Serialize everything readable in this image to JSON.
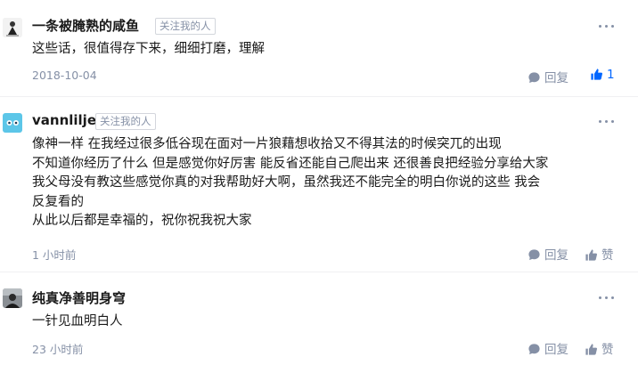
{
  "comments": [
    {
      "author": "一条被腌熟的咸鱼",
      "follow_tag": "关注我的人",
      "lines": [
        "这些话，很值得存下来，细细打磨，理解"
      ],
      "time": "2018-10-04",
      "reply_label": "回复",
      "like_label": "1",
      "liked": true
    },
    {
      "author": "vannlilje",
      "follow_tag": "关注我的人",
      "lines": [
        "像神一样 在我经过很多低谷现在面对一片狼藉想收拾又不得其法的时候突兀的出现",
        "不知道你经历了什么 但是感觉你好厉害 能反省还能自己爬出来 还很善良把经验分享给大家",
        "我父母没有教这些感觉你真的对我帮助好大啊，虽然我还不能完全的明白你说的这些 我会",
        "反复看的",
        "从此以后都是幸福的，祝你祝我祝大家"
      ],
      "time": "1 小时前",
      "reply_label": "回复",
      "like_label": "赞",
      "liked": false
    },
    {
      "author": "纯真净善明身穹",
      "follow_tag": "",
      "lines": [
        "一针见血明白人"
      ],
      "time": "23 小时前",
      "reply_label": "回复",
      "like_label": "赞",
      "liked": false
    }
  ],
  "icons": {
    "more": "more-horizontal-icon",
    "reply": "comment-bubble-icon",
    "like": "thumbs-up-icon"
  },
  "colors": {
    "accent": "#0066ff",
    "meta": "#8590a6",
    "text": "#1a1a1a"
  }
}
